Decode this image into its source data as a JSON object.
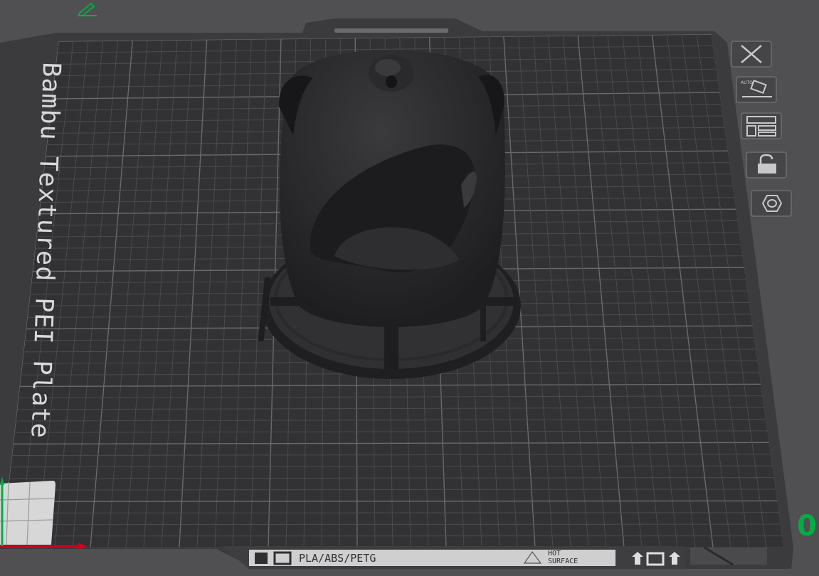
{
  "plate": {
    "label": "Bambu Textured PEI Plate",
    "material_label": "PLA/ABS/PETG",
    "hot_surface_line1": "HOT",
    "hot_surface_line2": "SURFACE"
  },
  "indicators": {
    "plate_index": "0"
  },
  "side_toolbar": [
    {
      "name": "delete-plate-button",
      "icon": "close-icon"
    },
    {
      "name": "auto-orient-button",
      "icon": "auto-orient-icon",
      "text": "AUTO"
    },
    {
      "name": "arrange-button",
      "icon": "arrange-icon"
    },
    {
      "name": "lock-plate-button",
      "icon": "lock-icon"
    },
    {
      "name": "plate-settings-button",
      "icon": "hexagon-icon"
    }
  ],
  "colors": {
    "background": "#505052",
    "plate": "#2f2f32",
    "grid": "#5a5a5e",
    "model": "#262628",
    "accent_green": "#00ae42",
    "axis_red": "#d0021b"
  }
}
